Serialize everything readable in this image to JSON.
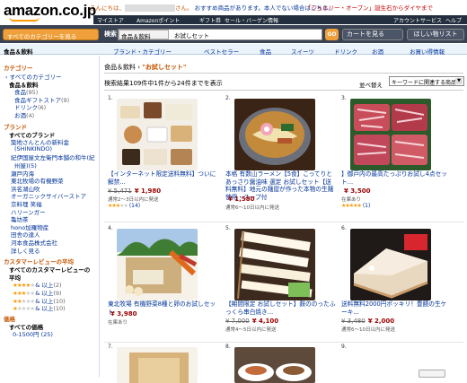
{
  "header": {
    "logo": "amazon.co.jp",
    "greeting_prefix": "こんにちは、",
    "greeting_suffix": "さん。",
    "recommend_link": "おすすめ商品",
    "greeting_rest": "があります。本人でない場合はこちら。",
    "promo": "「ジュエリー・オープン」誕生石からダイヤまで",
    "nav": [
      "マイストア",
      "Amazonポイント",
      "ギフト券",
      "セール・バーゲン情報",
      "アカウントサービス",
      "ヘルプ"
    ]
  },
  "search": {
    "category_button": "すべてのカテゴリーを見る",
    "label": "検索",
    "scope": "食品＆飲料",
    "query": "お試しセット",
    "go": "GO",
    "cart": "カートを見る",
    "wishlist": "ほしい物リスト"
  },
  "subnav": {
    "home": "食品＆飲料",
    "items": [
      "ブランド・カテゴリー",
      "ベストセラー",
      "食品",
      "スイーツ",
      "ドリンク",
      "お酒",
      "お買い得情報"
    ]
  },
  "sidebar": {
    "category_heading": "カテゴリー",
    "categories": [
      {
        "label": "‹ すべてのカテゴリー",
        "count": "",
        "style": "lk"
      },
      {
        "label": "食品＆飲料",
        "count": "",
        "style": "b"
      },
      {
        "label": "食品",
        "count": "(95)",
        "style": "lk"
      },
      {
        "label": "食品ギフトストア",
        "count": "(9)",
        "style": "lk"
      },
      {
        "label": "ドリンク",
        "count": "(6)",
        "style": "lk"
      },
      {
        "label": "お酒",
        "count": "(4)",
        "style": "lk"
      }
    ],
    "brand_heading": "ブランド",
    "brands": [
      {
        "label": "すべてのブランド",
        "style": "b"
      },
      {
        "label": "築地さんとんの新料金",
        "style": "lk"
      },
      {
        "label": "(SHINKINDO)",
        "style": "lk"
      },
      {
        "label": "紀伊国屋文左衛門本舗の和牛(紀",
        "style": "lk"
      },
      {
        "label": "州屋)(5)",
        "style": "lk"
      },
      {
        "label": "瀬戸内海",
        "style": "lk"
      },
      {
        "label": "東北牧場の有機野菜",
        "style": "lk"
      },
      {
        "label": "浜名湖山吹",
        "style": "lk"
      },
      {
        "label": "オーガニックサイバーストア",
        "style": "lk"
      },
      {
        "label": "京料理 笑福",
        "style": "lk"
      },
      {
        "label": "ハリーンガー",
        "style": "lk"
      },
      {
        "label": "亀坊茶",
        "style": "lk"
      },
      {
        "label": "hono加羅物産",
        "style": "lk"
      },
      {
        "label": "田舎の達人",
        "style": "lk"
      },
      {
        "label": "河本食品株式会社",
        "style": "lk"
      },
      {
        "label": "詳しく見る",
        "style": "lk"
      }
    ],
    "review_heading": "カスタマーレビューの平均",
    "reviews": [
      {
        "label": "すべてのカスタマーレビューの",
        "stars": 0
      },
      {
        "label": "平均",
        "stars": 0
      },
      {
        "label": "& 以上",
        "count": "(2)",
        "stars": 4
      },
      {
        "label": "& 以上",
        "count": "(9)",
        "stars": 3
      },
      {
        "label": "& 以上",
        "count": "(10)",
        "stars": 2
      },
      {
        "label": "& 以上",
        "count": "(10)",
        "stars": 1
      }
    ],
    "price_heading": "価格",
    "prices": [
      "すべての価格",
      "0-1500円 (25)"
    ]
  },
  "results": {
    "breadcrumb_prefix": "食品＆飲料 › ",
    "breadcrumb_query": "\"お試しセット\"",
    "count_text": "検索結果109件中1件から24件までを表示",
    "sort_label": "並べ替え",
    "sort_value": "キーワードに関連する商品",
    "products": [
      {
        "num": "1.",
        "title": "【インターネット限定送料無料】ついに解禁...",
        "old": "¥ 5,471",
        "new": "¥ 1,980",
        "ship": "通常2～3日以内に発送",
        "stars": 3,
        "reviews": "(14)",
        "img": "sweets"
      },
      {
        "num": "2.",
        "title": "本格 有数山ラーメン【5食】こってりとあっさり醤油味 選定 お試しセット【送料無料】地元の麺屋が作った本物の生麺使用・スープ付",
        "old": "",
        "new": "¥ 1,580",
        "ship": "通常6～10日以内に発送",
        "stars": 0,
        "reviews": "",
        "img": "ramen"
      },
      {
        "num": "3.",
        "title": "】御戸内の最高たっぷりお試し4点セット...",
        "old": "",
        "new": "¥ 3,500",
        "ship": "在庫あり",
        "stars": 5,
        "reviews": "(1)",
        "img": "beef"
      },
      {
        "num": "4.",
        "title": "東北牧場 有機野菜8種と卵のお試しセット",
        "old": "",
        "new": "¥ 3,980",
        "ship": "在庫あり",
        "stars": 0,
        "reviews": "",
        "img": "veg"
      },
      {
        "num": "5.",
        "title": "【期間限定 お試しセット】麩ののったふっくら串白焼き...",
        "old": "¥ 7,000",
        "new": "¥ 4,100",
        "ship": "通常4～5日以内に発送",
        "stars": 0,
        "reviews": "",
        "img": "skewer"
      },
      {
        "num": "6.",
        "title": "送料無料2000円ポッキリ！豊饒の生ケーキ...",
        "old": "¥ 3,480",
        "new": "¥ 2,000",
        "ship": "通常6～10日以内に発送",
        "stars": 0,
        "reviews": "",
        "img": "cake"
      },
      {
        "num": "7.",
        "title": "",
        "img": "box"
      },
      {
        "num": "8.",
        "title": "",
        "img": "plates"
      },
      {
        "num": "9.",
        "title": "",
        "img": "none"
      }
    ]
  },
  "colors": {
    "accent": "#c45500",
    "link": "#003399",
    "price": "#990000",
    "nav": "#232f3e",
    "button": "#f0a03a"
  }
}
